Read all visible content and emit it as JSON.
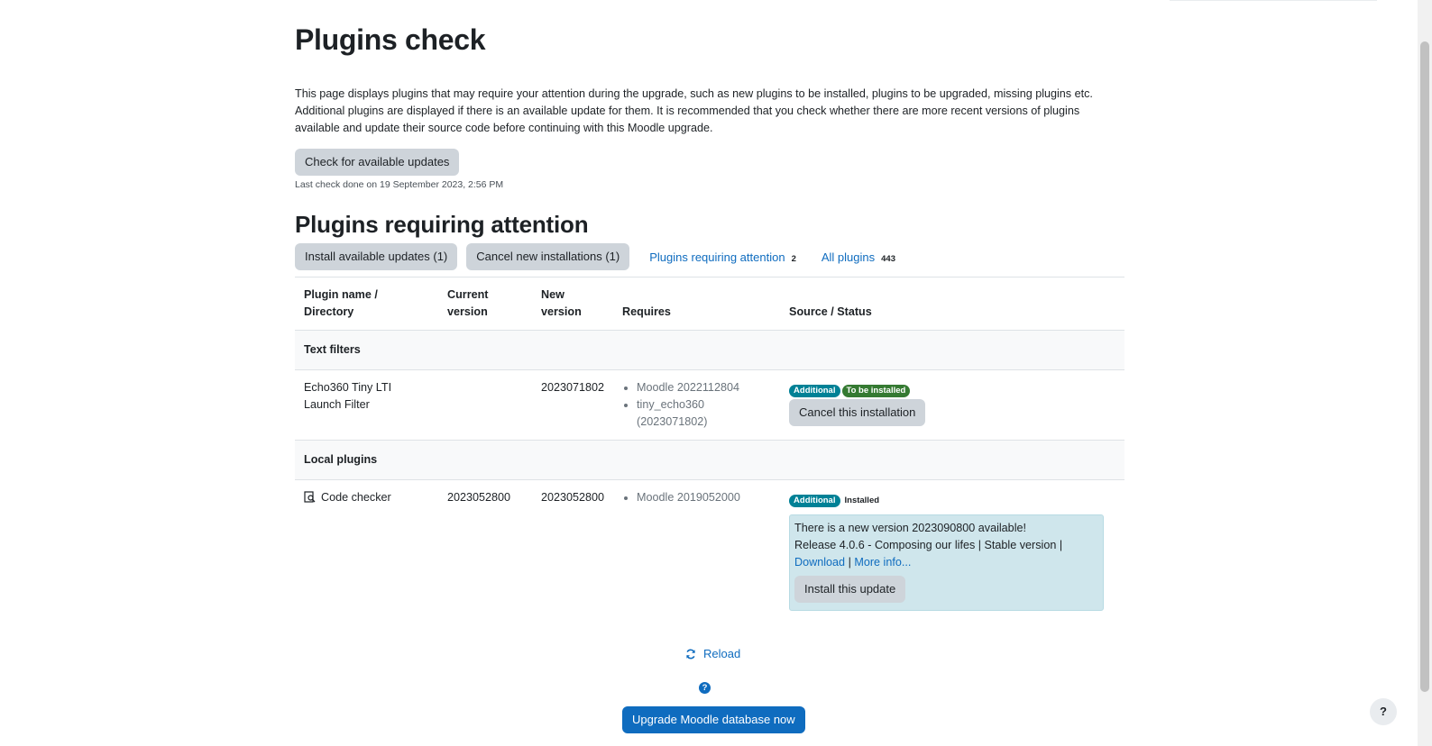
{
  "page": {
    "title": "Plugins check",
    "intro": "This page displays plugins that may require your attention during the upgrade, such as new plugins to be installed, plugins to be upgraded, missing plugins etc. Additional plugins are displayed if there is an available update for them. It is recommended that you check whether there are more recent versions of plugins available and update their source code before continuing with this Moodle upgrade.",
    "check_button": "Check for available updates",
    "last_check": "Last check done on 19 September 2023, 2:56 PM"
  },
  "attention": {
    "heading": "Plugins requiring attention",
    "install_updates_button": "Install available updates (1)",
    "cancel_installs_button": "Cancel new installations (1)",
    "filter_attention_label": "Plugins requiring attention",
    "filter_attention_count": "2",
    "filter_all_label": "All plugins",
    "filter_all_count": "443"
  },
  "table": {
    "headers": {
      "name": "Plugin name / Directory",
      "current": "Current version",
      "new": "New version",
      "requires": "Requires",
      "status": "Source / Status"
    },
    "groups": [
      {
        "label": "Text filters",
        "plugin": {
          "name": "Echo360 Tiny LTI Launch Filter",
          "current": "",
          "new": "2023071802",
          "requires": [
            "Moodle 2022112804",
            "tiny_echo360 (2023071802)"
          ],
          "badge_source": "Additional",
          "badge_status": "To be installed",
          "action_button": "Cancel this installation"
        }
      },
      {
        "label": "Local plugins",
        "plugin": {
          "name": "Code checker",
          "current": "2023052800",
          "new": "2023052800",
          "requires": [
            "Moodle 2019052000"
          ],
          "badge_source": "Additional",
          "badge_status": "Installed",
          "update": {
            "message": "There is a new version 2023090800 available!",
            "release": "Release 4.0.6 - Composing our lifes | Stable version |",
            "download": "Download",
            "separator": "|",
            "more_info": "More info...",
            "install_button": "Install this update"
          }
        }
      }
    ]
  },
  "footer": {
    "reload": "Reload",
    "upgrade_button": "Upgrade Moodle database now",
    "help_fab": "?"
  },
  "colors": {
    "primary": "#0f6cbf",
    "badge_info": "#008196",
    "badge_success": "#357a32",
    "update_box": "#cfe6ec"
  }
}
